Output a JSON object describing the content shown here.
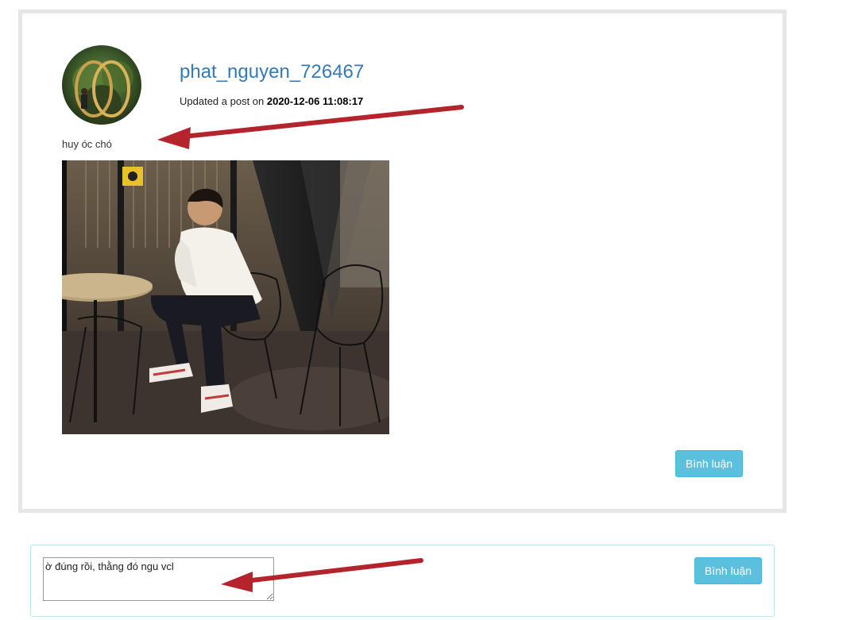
{
  "post": {
    "username": "phat_nguyen_726467",
    "meta_prefix": "Updated a post on ",
    "timestamp": "2020-12-06 11:08:17",
    "caption": "huy óc chó",
    "comment_button": "Bình luận"
  },
  "comment_form": {
    "text": "ờ đúng rồi, thằng đó ngu vcl",
    "submit_button": "Bình luận"
  },
  "colors": {
    "link": "#337ab7",
    "button": "#5bc0de",
    "annotation_arrow": "#b5242c"
  },
  "icons": [
    "annotation-arrow-icon"
  ]
}
